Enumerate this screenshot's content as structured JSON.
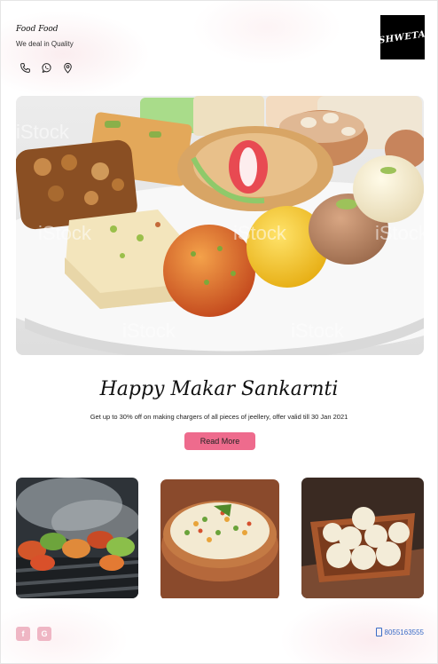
{
  "header": {
    "brand_title": "Food Food",
    "tagline": "We deal in Quality",
    "logo_text": "SHWETA",
    "contact_icons": [
      "phone-icon",
      "whatsapp-icon",
      "location-pin-icon"
    ]
  },
  "hero": {
    "image_subject": "plate of assorted Indian sweets",
    "watermark": "iStock"
  },
  "promo": {
    "headline": "Happy Makar Sankarnti",
    "offer_text": "Get up to 30% off on making chargers of all pieces of jeellery, offer valid till 30 Jan 2021",
    "button_label": "Read More",
    "button_color": "#ee6b8d"
  },
  "gallery": [
    {
      "subject": "grilled skewers"
    },
    {
      "subject": "vegetable biryani"
    },
    {
      "subject": "coconut laddoo"
    }
  ],
  "footer": {
    "social": [
      {
        "icon": "facebook-icon",
        "glyph": "f"
      },
      {
        "icon": "google-icon",
        "glyph": "G"
      }
    ],
    "phone": "8055163555"
  }
}
